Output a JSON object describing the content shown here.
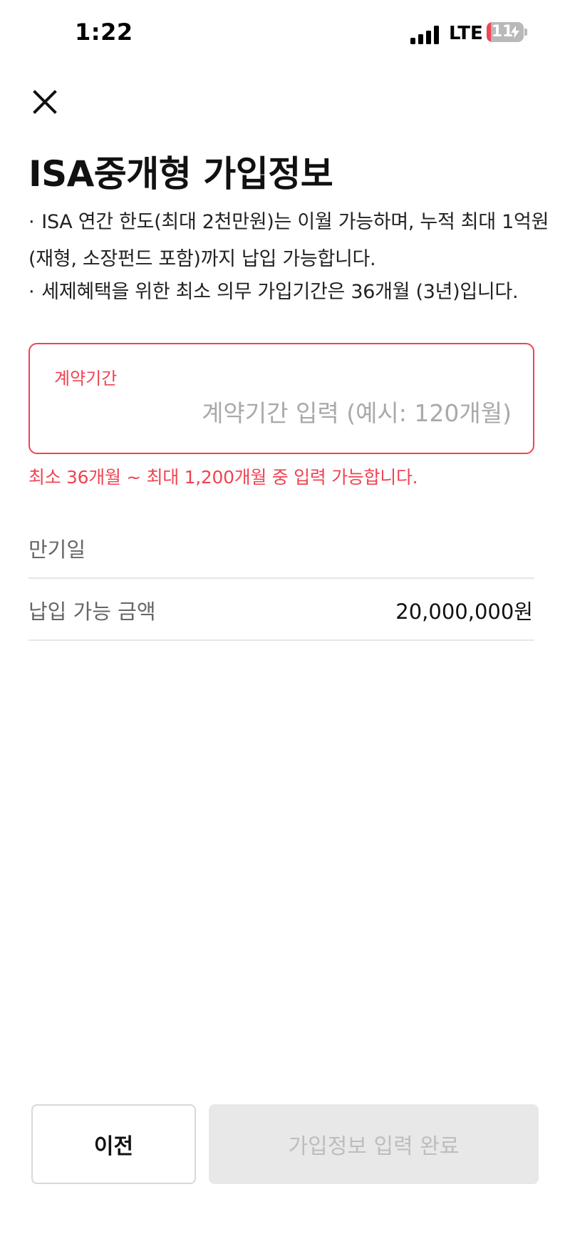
{
  "status_bar": {
    "time": "1:22",
    "network": "LTE",
    "battery": "11",
    "battery_level": 0.11
  },
  "header": {
    "close_icon": "close-icon",
    "title": "ISA중개형 가입정보"
  },
  "notices": [
    "ISA 연간 한도(최대 2천만원)는 이월 가능하며, 누적 최대 1억원(재형, 소장펀드 포함)까지 납입 가능합니다.",
    "세제혜택을 위한 최소 의무 가입기간은 36개월 (3년)입니다."
  ],
  "contract_period": {
    "label": "계약기간",
    "value": "",
    "placeholder": "계약기간 입력 (예시: 120개월)",
    "error": "최소 36개월 ~ 최대 1,200개월 중 입력 가능합니다."
  },
  "info_rows": {
    "maturity_label": "만기일",
    "maturity_value": "",
    "amount_label": "납입 가능 금액",
    "amount_value": "20,000,000원"
  },
  "buttons": {
    "prev_label": "이전",
    "complete_label": "가입정보 입력 완료"
  },
  "colors": {
    "error": "#ef4452",
    "disabled_button_bg": "#e8e8e8",
    "disabled_button_text": "#bdbdbd"
  }
}
